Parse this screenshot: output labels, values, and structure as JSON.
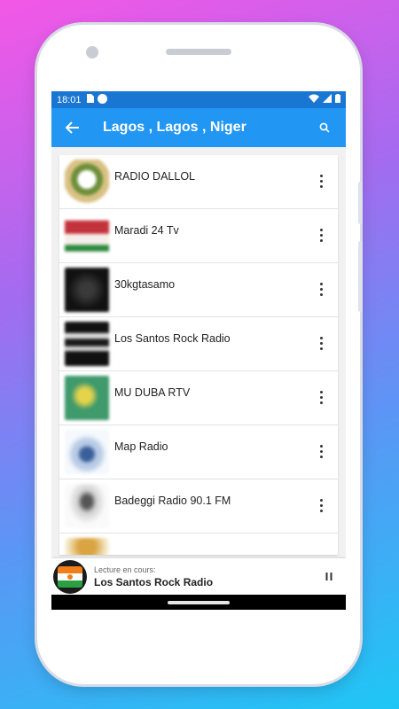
{
  "status_bar": {
    "time": "18:01"
  },
  "app_bar": {
    "title": "Lagos , Lagos , Niger"
  },
  "stations": [
    {
      "name": "RADIO DALLOL",
      "logo_color": "#e8d9a8"
    },
    {
      "name": "Maradi 24 Tv",
      "logo_color": "#f2e9e4"
    },
    {
      "name": "30kgtasamo",
      "logo_color": "#111111"
    },
    {
      "name": "Los Santos Rock Radio",
      "logo_color": "#1a1a1a"
    },
    {
      "name": "MU DUBA RTV",
      "logo_color": "#3f9a6c"
    },
    {
      "name": "Map Radio",
      "logo_color": "#e7eef7"
    },
    {
      "name": "Badeggi Radio 90.1 FM",
      "logo_color": "#f0f0f0"
    }
  ],
  "now_playing": {
    "label": "Lecture en cours:",
    "title": "Los Santos Rock Radio"
  },
  "colors": {
    "status_bar": "#1976d2",
    "app_bar": "#2196f3"
  }
}
